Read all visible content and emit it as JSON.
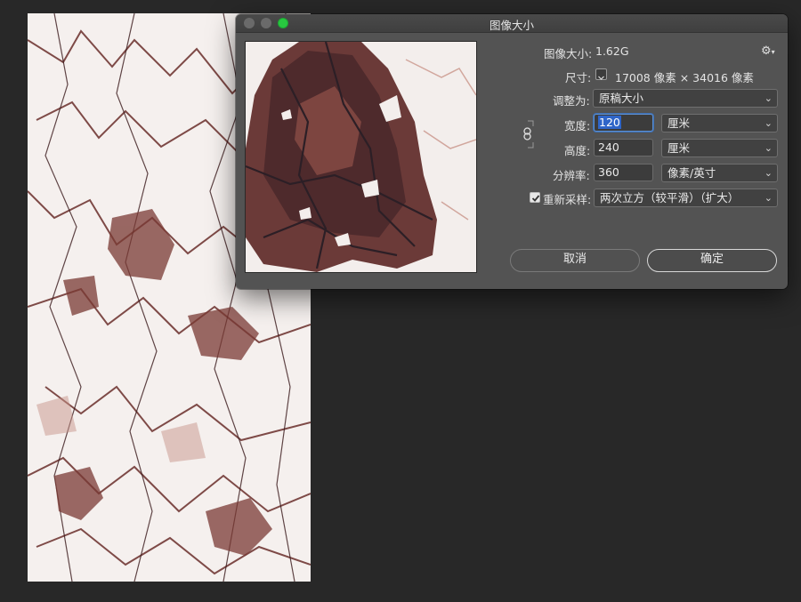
{
  "dialog": {
    "title": "图像大小",
    "image_size_label": "图像大小:",
    "image_size_value": "1.62G",
    "dimensions_label": "尺寸:",
    "dimensions_value": "17008 像素  ×  34016 像素",
    "fit_to_label": "调整为:",
    "fit_to_value": "原稿大小",
    "width_label": "宽度:",
    "width_value": "120",
    "width_unit": "厘米",
    "height_label": "高度:",
    "height_value": "240",
    "height_unit": "厘米",
    "resolution_label": "分辨率:",
    "resolution_value": "360",
    "resolution_unit": "像素/英寸",
    "resample_label": "重新采样:",
    "resample_checked": true,
    "resample_value": "两次立方（较平滑）（扩大）",
    "cancel_label": "取消",
    "ok_label": "确定"
  },
  "icons": {
    "gear": "gear-icon",
    "chain": "chain-link-icon",
    "chevron": "chevron-down-icon"
  },
  "colors": {
    "dialog_bg": "#535353",
    "workspace_bg": "#282828",
    "focus_blue": "#2f65c8",
    "zoom_green": "#28c840"
  }
}
